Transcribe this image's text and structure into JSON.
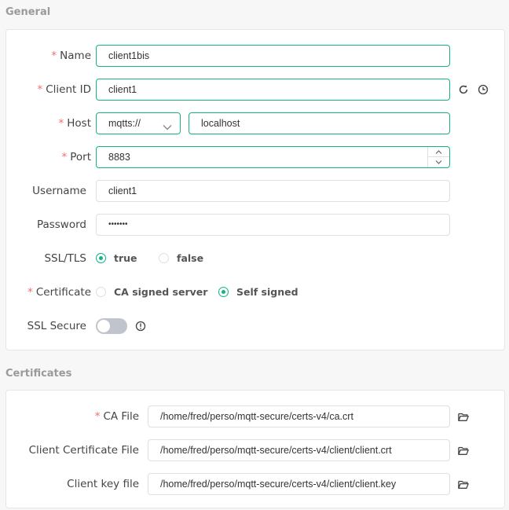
{
  "general": {
    "title": "General",
    "name": {
      "label": "Name",
      "value": "client1bis"
    },
    "client_id": {
      "label": "Client ID",
      "value": "client1"
    },
    "host": {
      "label": "Host",
      "protocol": "mqtts://",
      "value": "localhost"
    },
    "port": {
      "label": "Port",
      "value": "8883"
    },
    "username": {
      "label": "Username",
      "value": "client1"
    },
    "password": {
      "label": "Password",
      "value": "•••••••"
    },
    "ssl_tls": {
      "label": "SSL/TLS",
      "options": [
        "true",
        "false"
      ],
      "selected": "true"
    },
    "certificate": {
      "label": "Certificate",
      "options": [
        "CA signed server",
        "Self signed"
      ],
      "selected": "Self signed"
    },
    "ssl_secure": {
      "label": "SSL Secure",
      "enabled": false
    }
  },
  "certificates": {
    "title": "Certificates",
    "ca_file": {
      "label": "CA File",
      "value": "/home/fred/perso/mqtt-secure/certs-v4/ca.crt"
    },
    "client_cert": {
      "label": "Client Certificate File",
      "value": "/home/fred/perso/mqtt-secure/certs-v4/client/client.crt"
    },
    "client_key": {
      "label": "Client key file",
      "value": "/home/fred/perso/mqtt-secure/certs-v4/client/client.key"
    }
  },
  "required_marker": "*",
  "icons": {
    "refresh": "refresh-icon",
    "history": "clock-icon",
    "info": "info-icon",
    "folder": "folder-icon",
    "select_arrow": "chevron-down-icon"
  },
  "colors": {
    "accent": "#13b386",
    "required": "#f56c6c"
  }
}
